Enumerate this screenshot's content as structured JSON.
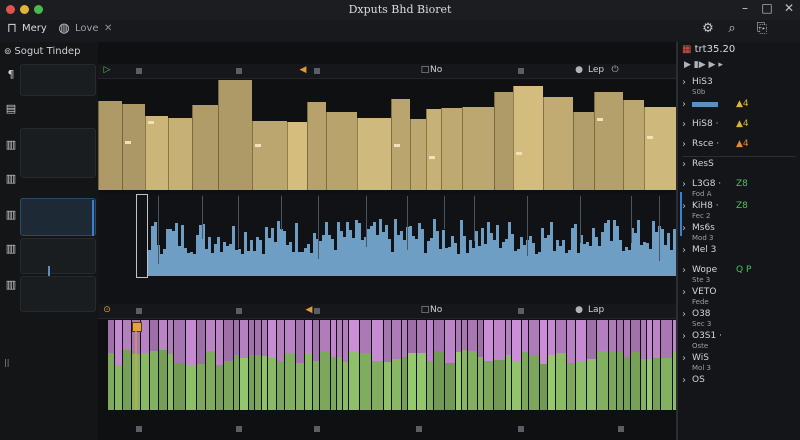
{
  "window": {
    "title": "Dxputs Bhd Bioret",
    "controls": [
      "–",
      "□",
      "✕"
    ],
    "traffic_colors": [
      "#e0534a",
      "#e0b43a",
      "#4cb94f"
    ]
  },
  "toolbar": {
    "menu_label": "Mery",
    "field_label": "Love",
    "close_glyph": "✕",
    "icons": [
      "menu-icon",
      "globe-icon",
      "gear-icon",
      "search-icon",
      "export-icon"
    ]
  },
  "sidebar": {
    "title": "Sogut Tindep",
    "button_glyphs": [
      "¶",
      "▤",
      "▥",
      "▥",
      "▥",
      "▥",
      "▥"
    ]
  },
  "lanes": [
    {
      "header": {
        "labels": [
          "No",
          "Lep"
        ],
        "play_glyph": "▷"
      },
      "color": "#cdb67a",
      "kind": "blocks"
    },
    {
      "header": {
        "labels": [],
        "play_glyph": ""
      },
      "color": "#6f9ec4",
      "kind": "waveform"
    },
    {
      "header": {
        "labels": [
          "No",
          "Lap"
        ],
        "play_glyph": "▷"
      },
      "colors": [
        "#b983c4",
        "#8fc069"
      ],
      "kind": "stack"
    }
  ],
  "rightpanel": {
    "header": "trt35.20",
    "items": [
      {
        "label": "HiS3",
        "sub": "S0b",
        "badge": "",
        "badge_color": ""
      },
      {
        "label": "",
        "sub": "",
        "badge": "▲4",
        "badge_color": "#e0b43a"
      },
      {
        "label": "HiS8 ·",
        "sub": "",
        "badge": "▲4",
        "badge_color": "#d8b23a"
      },
      {
        "label": "Rsce ·",
        "sub": "",
        "badge": "▲4",
        "badge_color": "#e08a3a"
      },
      {
        "label": "ResS",
        "sub": "",
        "badge": "",
        "badge_color": ""
      },
      {
        "label": "L3G8 ·",
        "sub": "Fod A",
        "badge": "Z8",
        "badge_color": "#52c05a"
      },
      {
        "label": "KiH8 ·",
        "sub": "Fec 2",
        "badge": "Z8",
        "badge_color": "#52c05a"
      },
      {
        "label": "Ms6s",
        "sub": "Mod 3",
        "badge": "",
        "badge_color": ""
      },
      {
        "label": "Mel 3",
        "sub": "",
        "badge": "",
        "badge_color": ""
      },
      {
        "label": "Wope",
        "sub": "Ste 3",
        "badge": "Q P",
        "badge_color": "#52c05a"
      },
      {
        "label": "VETO",
        "sub": "Fede",
        "badge": "",
        "badge_color": ""
      },
      {
        "label": "O38",
        "sub": "Sec 3",
        "badge": "",
        "badge_color": ""
      },
      {
        "label": "O3S1 ·",
        "sub": "Oste",
        "badge": "",
        "badge_color": ""
      },
      {
        "label": "WiS",
        "sub": "Mol 3",
        "badge": "",
        "badge_color": ""
      },
      {
        "label": "OS",
        "sub": "",
        "badge": "",
        "badge_color": ""
      }
    ]
  },
  "accent_color": "#3a7fd0"
}
